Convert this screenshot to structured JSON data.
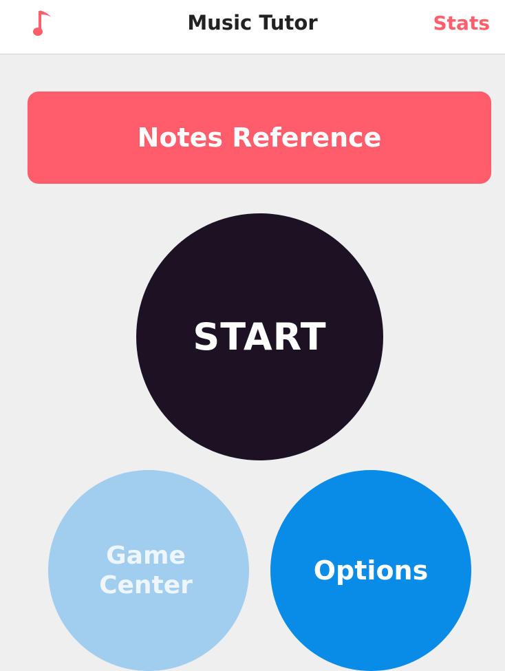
{
  "navbar": {
    "icon": "music-note-icon",
    "title": "Music Tutor",
    "stats_label": "Stats"
  },
  "buttons": {
    "notes_reference": "Notes Reference",
    "start": "START",
    "game_center_line1": "Game",
    "game_center_line2": "Center",
    "options": "Options"
  },
  "colors": {
    "accent": "#ff5d6b",
    "start_bg": "#1d1224",
    "game_center_bg": "#a1cdee",
    "options_bg": "#098be8",
    "background": "#efefef"
  }
}
